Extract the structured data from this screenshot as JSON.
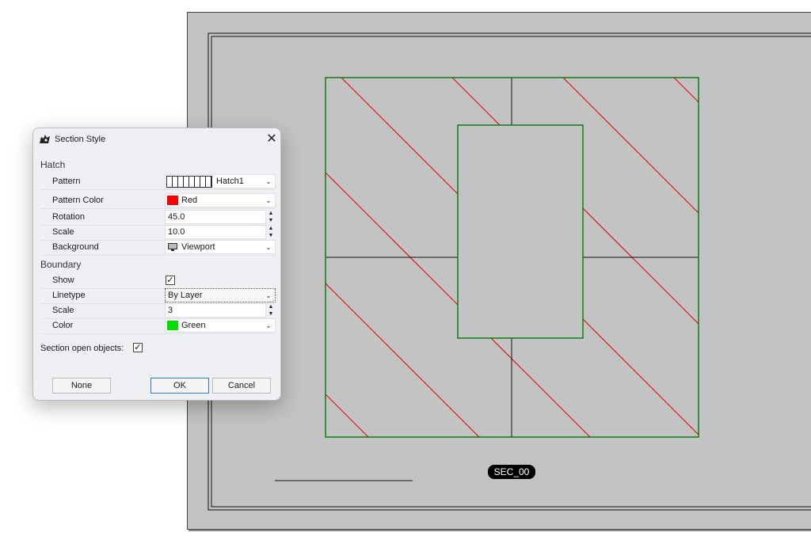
{
  "dialog": {
    "title": "Section Style",
    "close_glyph": "✕",
    "hatch": {
      "header": "Hatch",
      "pattern": {
        "label": "Pattern",
        "value": "Hatch1"
      },
      "pattern_color": {
        "label": "Pattern Color",
        "value": "Red",
        "color": "#ff0000"
      },
      "rotation": {
        "label": "Rotation",
        "value": "45.0"
      },
      "scale": {
        "label": "Scale",
        "value": "10.0"
      },
      "background": {
        "label": "Background",
        "value": "Viewport",
        "icon": "monitor-icon"
      }
    },
    "boundary": {
      "header": "Boundary",
      "show": {
        "label": "Show",
        "checked": true
      },
      "linetype": {
        "label": "Linetype",
        "value": "By Layer"
      },
      "scale": {
        "label": "Scale",
        "value": "3"
      },
      "color": {
        "label": "Color",
        "value": "Green",
        "color": "#00e000"
      }
    },
    "section_open_objects": {
      "label": "Section open objects:",
      "checked": true
    },
    "buttons": {
      "none": "None",
      "ok": "OK",
      "cancel": "Cancel"
    }
  },
  "viewport": {
    "label": "SEC_00",
    "hatch_color": "#e00000",
    "boundary_color": "#007a00"
  }
}
